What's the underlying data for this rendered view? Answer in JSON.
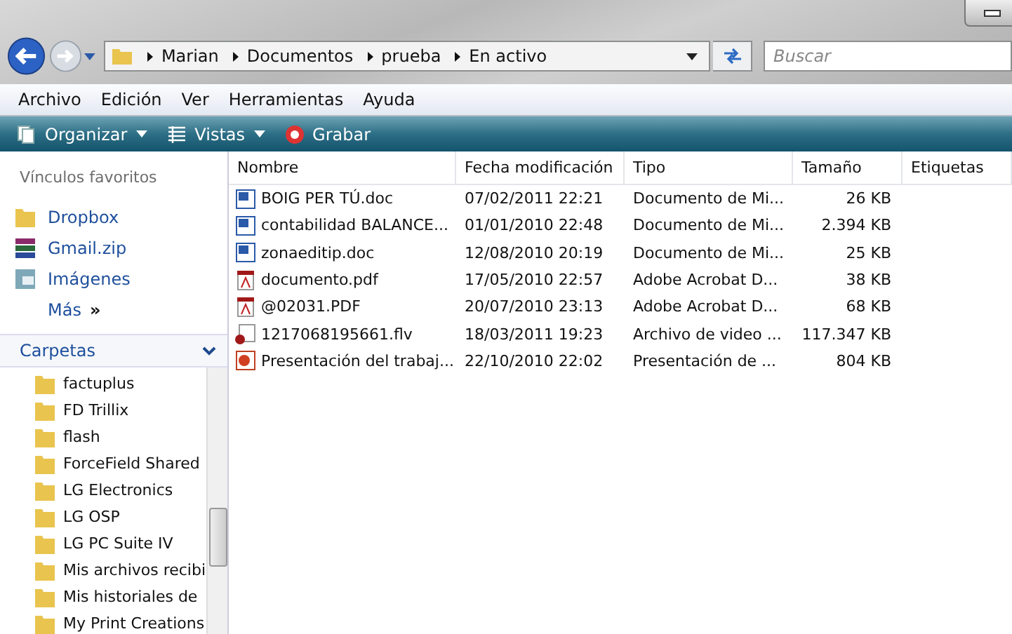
{
  "address": {
    "path": [
      "Marian",
      "Documentos",
      "prueba",
      "En activo"
    ]
  },
  "search": {
    "placeholder": "Buscar"
  },
  "menu": [
    "Archivo",
    "Edición",
    "Ver",
    "Herramientas",
    "Ayuda"
  ],
  "toolbar": [
    {
      "label": "Organizar",
      "kind": "organize",
      "dropdown": true
    },
    {
      "label": "Vistas",
      "kind": "views",
      "dropdown": true
    },
    {
      "label": "Grabar",
      "kind": "burn",
      "dropdown": false
    }
  ],
  "favorites": {
    "title": "Vínculos favoritos",
    "items": [
      {
        "label": "Dropbox",
        "kind": "folder"
      },
      {
        "label": "Gmail.zip",
        "kind": "archive"
      },
      {
        "label": "Imágenes",
        "kind": "images"
      }
    ],
    "more": "Más",
    "more_icon": "»"
  },
  "folders": {
    "title": "Carpetas",
    "items": [
      "factuplus",
      "FD Trillix",
      "flash",
      "ForceField Shared",
      "LG Electronics",
      "LG OSP",
      "LG PC Suite IV",
      "Mis archivos recibi",
      "Mis historiales de",
      "My Print Creations"
    ]
  },
  "table": {
    "columns": [
      "Nombre",
      "Fecha modificación",
      "Tipo",
      "Tamaño",
      "Etiquetas"
    ],
    "rows": [
      {
        "name": "BOIG PER TÚ.doc",
        "kind": "word",
        "date": "07/02/2011 22:21",
        "type": "Documento de Mi...",
        "size": "26 KB"
      },
      {
        "name": "contabilidad BALANCE...",
        "kind": "word",
        "date": "01/01/2010 22:48",
        "type": "Documento de Mi...",
        "size": "2.394 KB"
      },
      {
        "name": "zonaeditip.doc",
        "kind": "word",
        "date": "12/08/2010 20:19",
        "type": "Documento de Mi...",
        "size": "25 KB"
      },
      {
        "name": "documento.pdf",
        "kind": "pdf",
        "date": "17/05/2010 22:57",
        "type": "Adobe Acrobat D...",
        "size": "38 KB"
      },
      {
        "name": "@02031.PDF",
        "kind": "pdf",
        "date": "20/07/2010 23:13",
        "type": "Adobe Acrobat D...",
        "size": "68 KB"
      },
      {
        "name": "1217068195661.flv",
        "kind": "video",
        "date": "18/03/2011 19:23",
        "type": "Archivo de video ...",
        "size": "117.347 KB"
      },
      {
        "name": "Presentación del trabaj...",
        "kind": "slides",
        "date": "22/10/2010 22:02",
        "type": "Presentación de ...",
        "size": "804 KB"
      }
    ]
  }
}
